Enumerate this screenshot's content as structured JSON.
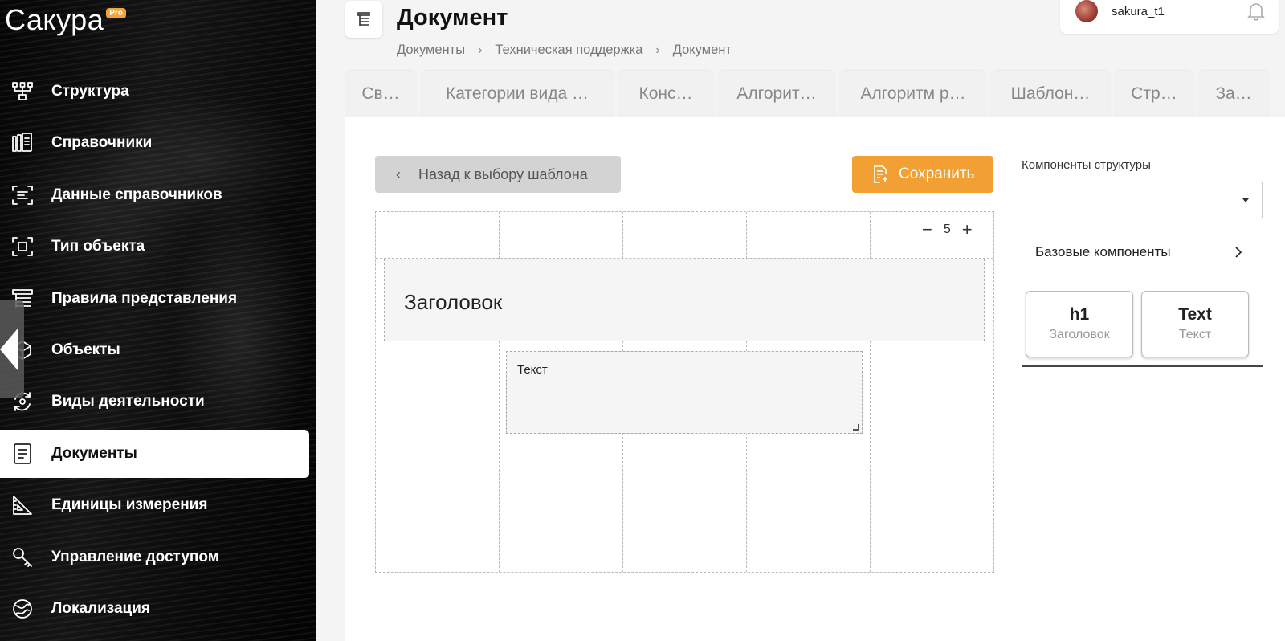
{
  "brand": {
    "name": "Сакура",
    "badge": "Pro"
  },
  "nav": {
    "items": [
      {
        "label": "Структура",
        "icon": "structure-icon",
        "name": "nav-item-structure",
        "active": false
      },
      {
        "label": "Справочники",
        "icon": "books-icon",
        "name": "nav-item-references",
        "active": false
      },
      {
        "label": "Данные справочников",
        "icon": "scan-list-icon",
        "name": "nav-item-reference-data",
        "active": false
      },
      {
        "label": "Тип объекта",
        "icon": "frame-icon",
        "name": "nav-item-object-type",
        "active": false
      },
      {
        "label": "Правила представления",
        "icon": "list-tree-icon",
        "name": "nav-item-view-rules",
        "active": false
      },
      {
        "label": "Объекты",
        "icon": "cube-icon",
        "name": "nav-item-objects",
        "active": false
      },
      {
        "label": "Виды деятельности",
        "icon": "cycle-icon",
        "name": "nav-item-activities",
        "active": false
      },
      {
        "label": "Документы",
        "icon": "document-icon",
        "name": "nav-item-documents",
        "active": true
      },
      {
        "label": "Единицы измерения",
        "icon": "ruler-triangle-icon",
        "name": "nav-item-units",
        "active": false
      },
      {
        "label": "Управление доступом",
        "icon": "key-icon",
        "name": "nav-item-access",
        "active": false
      },
      {
        "label": "Локализация",
        "icon": "globe-icon",
        "name": "nav-item-localization",
        "active": false
      }
    ]
  },
  "header": {
    "title": "Документ",
    "breadcrumb": [
      "Документы",
      "Техническая поддержка",
      "Документ"
    ],
    "user": {
      "name": "sakura_t1"
    }
  },
  "tabs": [
    {
      "label": "Св…",
      "width": 88
    },
    {
      "label": "Категории вида …",
      "width": 240
    },
    {
      "label": "Конс…",
      "width": 118
    },
    {
      "label": "Алгорит…",
      "width": 146
    },
    {
      "label": "Алгоритм р…",
      "width": 182
    },
    {
      "label": "Шаблон…",
      "width": 148
    },
    {
      "label": "Стр…",
      "width": 98
    },
    {
      "label": "За…",
      "width": 88
    }
  ],
  "editor": {
    "back_label": "Назад к выбору шаблона",
    "save_label": "Сохранить",
    "columns": "5",
    "heading_text": "Заголовок",
    "text_block": "Текст"
  },
  "panel": {
    "components_label": "Компоненты структуры",
    "select_value": "",
    "base_components": "Базовые компоненты",
    "cards": [
      {
        "title": "h1",
        "subtitle": "Заголовок"
      },
      {
        "title": "Text",
        "subtitle": "Текст"
      }
    ]
  }
}
